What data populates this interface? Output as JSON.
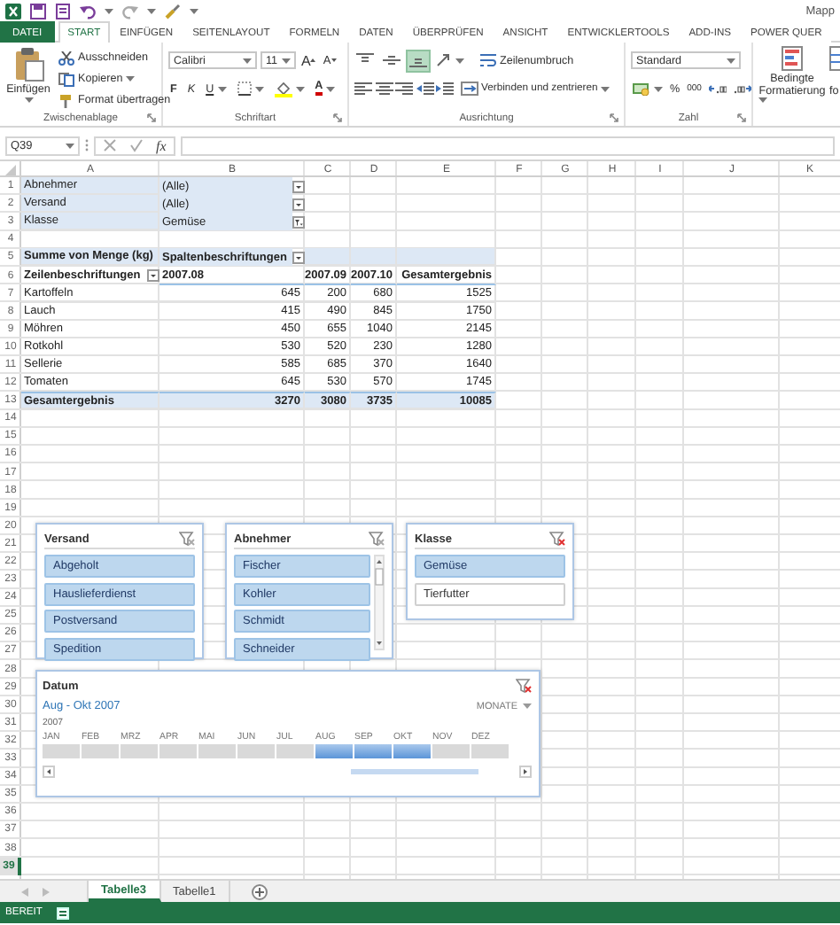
{
  "window": {
    "title": "Mapp"
  },
  "ribbon_tabs": [
    {
      "label": "DATEI",
      "kind": "file",
      "selected": false
    },
    {
      "label": "START",
      "kind": "tab",
      "selected": true
    },
    {
      "label": "EINFÜGEN",
      "kind": "tab",
      "selected": false
    },
    {
      "label": "SEITENLAYOUT",
      "kind": "tab",
      "selected": false
    },
    {
      "label": "FORMELN",
      "kind": "tab",
      "selected": false
    },
    {
      "label": "DATEN",
      "kind": "tab",
      "selected": false
    },
    {
      "label": "ÜBERPRÜFEN",
      "kind": "tab",
      "selected": false
    },
    {
      "label": "ANSICHT",
      "kind": "tab",
      "selected": false
    },
    {
      "label": "ENTWICKLERTOOLS",
      "kind": "tab",
      "selected": false
    },
    {
      "label": "ADD-INS",
      "kind": "tab",
      "selected": false
    },
    {
      "label": "POWER QUER",
      "kind": "tab",
      "selected": false
    }
  ],
  "ribbon": {
    "clipboard": {
      "paste": "Einfügen",
      "commands": [
        "Ausschneiden",
        "Kopieren",
        "Format übertragen"
      ],
      "label": "Zwischenablage"
    },
    "font": {
      "name": "Calibri",
      "size": "11",
      "grow": "A",
      "shrink": "A",
      "bold": "F",
      "italic": "K",
      "underline": "U",
      "color_button": "A",
      "label": "Schriftart"
    },
    "alignment": {
      "vertical": [
        {
          "selected": false
        },
        {
          "selected": false
        },
        {
          "selected": true
        }
      ],
      "wrap": "Zeilenumbruch",
      "merge": "Verbinden und zentrieren",
      "label": "Ausrichtung"
    },
    "number": {
      "format": "Standard",
      "percent": "%",
      "thousands": "000",
      "label": "Zahl"
    },
    "styles": {
      "conditional": "Bedingte Formatierung",
      "next": "fo"
    }
  },
  "formula_bar": {
    "name_box": "Q39",
    "function": "fx"
  },
  "sheet": {
    "columns": [
      "A",
      "B",
      "C",
      "D",
      "E",
      "F",
      "G",
      "H",
      "I",
      "J",
      "K"
    ],
    "rows": [
      {
        "number": "1",
        "selected": false
      },
      {
        "number": "2",
        "selected": false
      },
      {
        "number": "3",
        "selected": false
      },
      {
        "number": "4",
        "selected": false
      },
      {
        "number": "5",
        "selected": false
      },
      {
        "number": "6",
        "selected": false
      },
      {
        "number": "7",
        "selected": false
      },
      {
        "number": "8",
        "selected": false
      },
      {
        "number": "9",
        "selected": false
      },
      {
        "number": "10",
        "selected": false
      },
      {
        "number": "11",
        "selected": false
      },
      {
        "number": "12",
        "selected": false
      },
      {
        "number": "13",
        "selected": false
      },
      {
        "number": "14",
        "selected": false
      },
      {
        "number": "15",
        "selected": false
      },
      {
        "number": "16",
        "selected": false
      },
      {
        "number": "17",
        "selected": false
      },
      {
        "number": "18",
        "selected": false
      },
      {
        "number": "19",
        "selected": false
      },
      {
        "number": "20",
        "selected": false
      },
      {
        "number": "21",
        "selected": false
      },
      {
        "number": "22",
        "selected": false
      },
      {
        "number": "23",
        "selected": false
      },
      {
        "number": "24",
        "selected": false
      },
      {
        "number": "25",
        "selected": false
      },
      {
        "number": "26",
        "selected": false
      },
      {
        "number": "27",
        "selected": false
      },
      {
        "number": "28",
        "selected": false
      },
      {
        "number": "29",
        "selected": false
      },
      {
        "number": "30",
        "selected": false
      },
      {
        "number": "31",
        "selected": false
      },
      {
        "number": "32",
        "selected": false
      },
      {
        "number": "33",
        "selected": false
      },
      {
        "number": "34",
        "selected": false
      },
      {
        "number": "35",
        "selected": false
      },
      {
        "number": "36",
        "selected": false
      },
      {
        "number": "37",
        "selected": false
      },
      {
        "number": "38",
        "selected": false
      },
      {
        "number": "39",
        "selected": true
      }
    ]
  },
  "pivot": {
    "filters": [
      {
        "field": "Abnehmer",
        "value": "(Alle)",
        "filtered": false
      },
      {
        "field": "Versand",
        "value": "(Alle)",
        "filtered": false
      },
      {
        "field": "Klasse",
        "value": "Gemüse",
        "filtered": true
      }
    ],
    "measure": "Summe von Menge (kg)",
    "column_labels": "Spaltenbeschriftungen",
    "row_labels": "Zeilenbeschriftungen",
    "columns": [
      "2007.08",
      "2007.09",
      "2007.10",
      "Gesamtergebnis"
    ],
    "rows": [
      {
        "label": "Kartoffeln",
        "values": [
          "645",
          "200",
          "680",
          "1525"
        ]
      },
      {
        "label": "Lauch",
        "values": [
          "415",
          "490",
          "845",
          "1750"
        ]
      },
      {
        "label": "Möhren",
        "values": [
          "450",
          "655",
          "1040",
          "2145"
        ]
      },
      {
        "label": "Rotkohl",
        "values": [
          "530",
          "520",
          "230",
          "1280"
        ]
      },
      {
        "label": "Sellerie",
        "values": [
          "585",
          "685",
          "370",
          "1640"
        ]
      },
      {
        "label": "Tomaten",
        "values": [
          "645",
          "530",
          "570",
          "1745"
        ]
      }
    ],
    "total": {
      "label": "Gesamtergebnis",
      "values": [
        "3270",
        "3080",
        "3735",
        "10085"
      ]
    }
  },
  "slicers": [
    {
      "title": "Versand",
      "filtered": false,
      "scrollbar": false,
      "items": [
        {
          "label": "Abgeholt",
          "selected": true
        },
        {
          "label": "Hauslieferdienst",
          "selected": true
        },
        {
          "label": "Postversand",
          "selected": true
        },
        {
          "label": "Spedition",
          "selected": true
        }
      ]
    },
    {
      "title": "Abnehmer",
      "filtered": false,
      "scrollbar": true,
      "items": [
        {
          "label": "Fischer",
          "selected": true
        },
        {
          "label": "Kohler",
          "selected": true
        },
        {
          "label": "Schmidt",
          "selected": true
        },
        {
          "label": "Schneider",
          "selected": true
        }
      ]
    },
    {
      "title": "Klasse",
      "filtered": true,
      "scrollbar": false,
      "items": [
        {
          "label": "Gemüse",
          "selected": true
        },
        {
          "label": "Tierfutter",
          "selected": false
        }
      ]
    }
  ],
  "timeline": {
    "title": "Datum",
    "filtered": true,
    "range": "Aug - Okt 2007",
    "level": "MONATE",
    "year": "2007",
    "months": [
      {
        "label": "JAN",
        "selected": false
      },
      {
        "label": "FEB",
        "selected": false
      },
      {
        "label": "MRZ",
        "selected": false
      },
      {
        "label": "APR",
        "selected": false
      },
      {
        "label": "MAI",
        "selected": false
      },
      {
        "label": "JUN",
        "selected": false
      },
      {
        "label": "JUL",
        "selected": false
      },
      {
        "label": "AUG",
        "selected": true
      },
      {
        "label": "SEP",
        "selected": true
      },
      {
        "label": "OKT",
        "selected": true
      },
      {
        "label": "NOV",
        "selected": false
      },
      {
        "label": "DEZ",
        "selected": false
      }
    ]
  },
  "sheet_tabs": [
    {
      "label": "Tabelle3",
      "selected": true
    },
    {
      "label": "Tabelle1",
      "selected": false
    }
  ],
  "status_bar": {
    "text": "BEREIT"
  }
}
